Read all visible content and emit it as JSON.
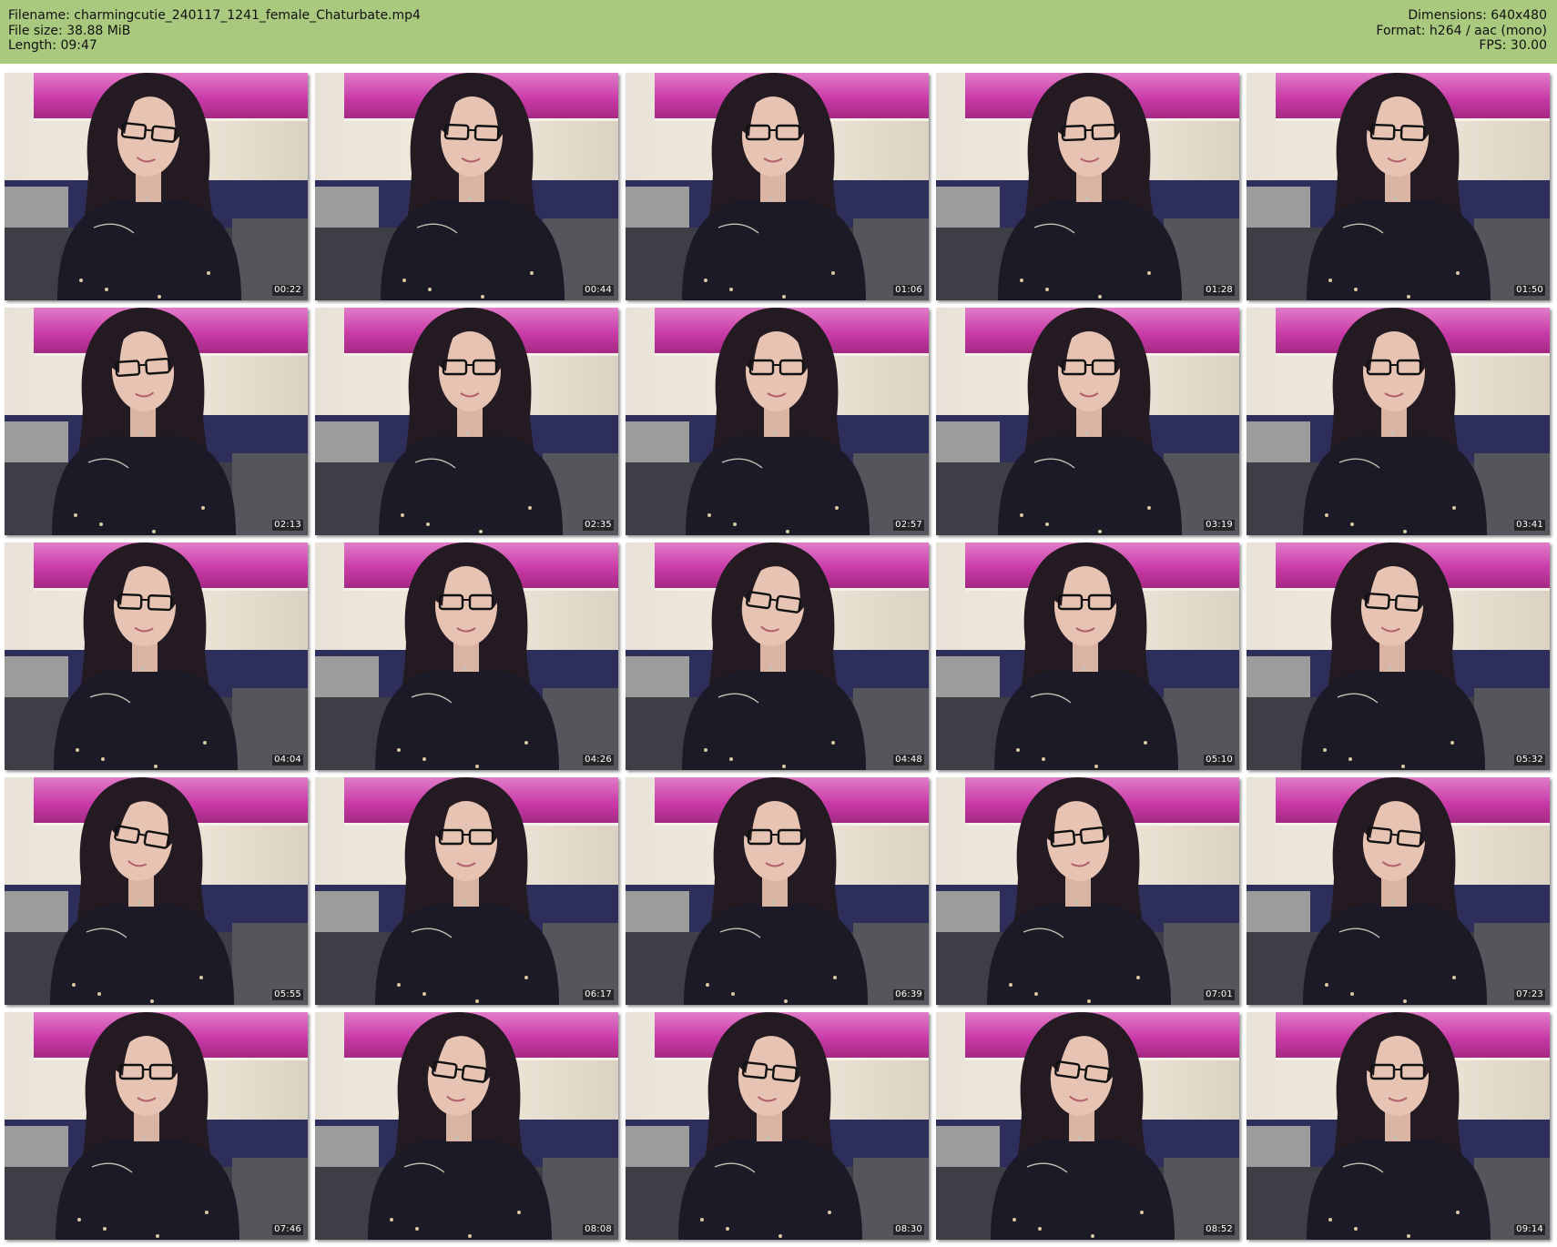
{
  "header": {
    "filename_line": "Filename: charmingcutie_240117_1241_female_Chaturbate.mp4",
    "filesize_line": "File size: 38.88 MiB",
    "length_line": "Length: 09:47",
    "dimensions_line": "Dimensions: 640x480",
    "format_line": "Format: h264 / aac (mono)",
    "fps_line": "FPS: 30.00"
  },
  "colors": {
    "header_background": "#a9c97f",
    "page_background": "#ffffff",
    "poster_pink": "#c93aa8"
  },
  "thumbnails": [
    {
      "time": "00:22"
    },
    {
      "time": "00:44"
    },
    {
      "time": "01:06"
    },
    {
      "time": "01:28"
    },
    {
      "time": "01:50"
    },
    {
      "time": "02:13"
    },
    {
      "time": "02:35"
    },
    {
      "time": "02:57"
    },
    {
      "time": "03:19"
    },
    {
      "time": "03:41"
    },
    {
      "time": "04:04"
    },
    {
      "time": "04:26"
    },
    {
      "time": "04:48"
    },
    {
      "time": "05:10"
    },
    {
      "time": "05:32"
    },
    {
      "time": "05:55"
    },
    {
      "time": "06:17"
    },
    {
      "time": "06:39"
    },
    {
      "time": "07:01"
    },
    {
      "time": "07:23"
    },
    {
      "time": "07:46"
    },
    {
      "time": "08:08"
    },
    {
      "time": "08:30"
    },
    {
      "time": "08:52"
    },
    {
      "time": "09:14"
    }
  ]
}
